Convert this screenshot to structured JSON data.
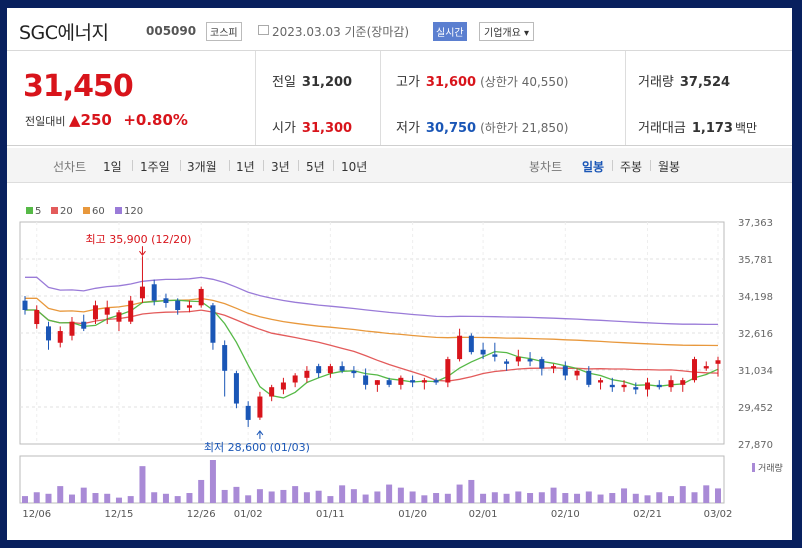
{
  "stock": {
    "name": "SGC에너지",
    "code": "005090",
    "market": "코스피",
    "date_note": "2023.03.03 기준(장마감)",
    "realtime_label": "실시간",
    "company_info_label": "기업개요 ▾"
  },
  "quote": {
    "price": "31,450",
    "change_label": "전일대비",
    "change_abs": "▲250",
    "change_pct": "+0.80%",
    "prev_close_label": "전일",
    "prev_close": "31,200",
    "high_label": "고가",
    "high": "31,600",
    "upper_limit_label": "(상한가 40,550)",
    "volume_label": "거래량",
    "volume": "37,524",
    "open_label": "시가",
    "open": "31,300",
    "low_label": "저가",
    "low": "30,750",
    "lower_limit_label": "(하한가 21,850)",
    "amount_label": "거래대금",
    "amount": "1,173",
    "amount_unit": "백만"
  },
  "tabs": {
    "line_chart_label": "선차트",
    "periods": [
      "1일",
      "1주일",
      "3개월",
      "1년",
      "3년",
      "5년",
      "10년"
    ],
    "candle_chart_label": "봉차트",
    "candle_periods": [
      "일봉",
      "주봉",
      "월봉"
    ],
    "selected_candle": "일봉"
  },
  "colors": {
    "up": "#d8141b",
    "down": "#1a56b6",
    "ma5": "#56b947",
    "ma20": "#e35b5b",
    "ma60": "#e8983c",
    "ma120": "#9a7bd8",
    "volume": "#a98ad6"
  },
  "chart_data": {
    "type": "candlestick",
    "legend": [
      {
        "name": "5",
        "color": "#56b947"
      },
      {
        "name": "20",
        "color": "#e35b5b"
      },
      {
        "name": "60",
        "color": "#e8983c"
      },
      {
        "name": "120",
        "color": "#9a7bd8"
      }
    ],
    "y_ticks": [
      "37,363",
      "35,781",
      "34,198",
      "32,616",
      "31,034",
      "29,452",
      "27,870"
    ],
    "ylim": [
      27870,
      37363
    ],
    "x_tick_labels": [
      {
        "label": "12/06",
        "index": 1
      },
      {
        "label": "12/15",
        "index": 8
      },
      {
        "label": "12/26",
        "index": 15
      },
      {
        "label": "01/02",
        "index": 19
      },
      {
        "label": "01/11",
        "index": 26
      },
      {
        "label": "01/20",
        "index": 33
      },
      {
        "label": "02/01",
        "index": 39
      },
      {
        "label": "02/10",
        "index": 46
      },
      {
        "label": "02/21",
        "index": 53
      },
      {
        "label": "03/02",
        "index": 59
      }
    ],
    "annotations": [
      {
        "text": "최고 35,900 (12/20)",
        "index": 10,
        "value": 35900,
        "kind": "high"
      },
      {
        "text": "최저 28,600 (01/03)",
        "index": 20,
        "value": 28600,
        "kind": "low"
      }
    ],
    "volume_label": "거래량",
    "candles": [
      {
        "o": 34000,
        "h": 34200,
        "l": 33400,
        "c": 33600
      },
      {
        "o": 33000,
        "h": 33800,
        "l": 32800,
        "c": 33600
      },
      {
        "o": 32900,
        "h": 33100,
        "l": 31900,
        "c": 32300
      },
      {
        "o": 32200,
        "h": 32900,
        "l": 32000,
        "c": 32700
      },
      {
        "o": 32500,
        "h": 33300,
        "l": 32300,
        "c": 33100
      },
      {
        "o": 33100,
        "h": 33400,
        "l": 32700,
        "c": 32800
      },
      {
        "o": 33200,
        "h": 34000,
        "l": 33000,
        "c": 33800
      },
      {
        "o": 33400,
        "h": 34000,
        "l": 33000,
        "c": 33700
      },
      {
        "o": 33100,
        "h": 33600,
        "l": 32700,
        "c": 33500
      },
      {
        "o": 33100,
        "h": 34200,
        "l": 33000,
        "c": 34000
      },
      {
        "o": 34100,
        "h": 35900,
        "l": 33900,
        "c": 34600
      },
      {
        "o": 34700,
        "h": 34900,
        "l": 33800,
        "c": 34000
      },
      {
        "o": 34100,
        "h": 34300,
        "l": 33700,
        "c": 33900
      },
      {
        "o": 34000,
        "h": 34100,
        "l": 33400,
        "c": 33600
      },
      {
        "o": 33700,
        "h": 34000,
        "l": 33500,
        "c": 33800
      },
      {
        "o": 33800,
        "h": 34600,
        "l": 33700,
        "c": 34500
      },
      {
        "o": 33800,
        "h": 33900,
        "l": 31900,
        "c": 32200
      },
      {
        "o": 32100,
        "h": 32300,
        "l": 29900,
        "c": 31000
      },
      {
        "o": 30900,
        "h": 31000,
        "l": 29400,
        "c": 29600
      },
      {
        "o": 29500,
        "h": 29700,
        "l": 28600,
        "c": 28900
      },
      {
        "o": 29000,
        "h": 30100,
        "l": 28900,
        "c": 29900
      },
      {
        "o": 29900,
        "h": 30400,
        "l": 29700,
        "c": 30300
      },
      {
        "o": 30200,
        "h": 30700,
        "l": 30000,
        "c": 30500
      },
      {
        "o": 30500,
        "h": 30900,
        "l": 30300,
        "c": 30800
      },
      {
        "o": 30700,
        "h": 31200,
        "l": 30500,
        "c": 31000
      },
      {
        "o": 31200,
        "h": 31300,
        "l": 30700,
        "c": 30900
      },
      {
        "o": 30900,
        "h": 31300,
        "l": 30700,
        "c": 31200
      },
      {
        "o": 31200,
        "h": 31400,
        "l": 30900,
        "c": 31000
      },
      {
        "o": 31000,
        "h": 31200,
        "l": 30700,
        "c": 30900
      },
      {
        "o": 30800,
        "h": 31100,
        "l": 30200,
        "c": 30400
      },
      {
        "o": 30400,
        "h": 30600,
        "l": 30100,
        "c": 30600
      },
      {
        "o": 30600,
        "h": 30700,
        "l": 30300,
        "c": 30400
      },
      {
        "o": 30400,
        "h": 30800,
        "l": 30200,
        "c": 30700
      },
      {
        "o": 30600,
        "h": 30800,
        "l": 30300,
        "c": 30500
      },
      {
        "o": 30500,
        "h": 30700,
        "l": 30200,
        "c": 30600
      },
      {
        "o": 30600,
        "h": 30700,
        "l": 30400,
        "c": 30500
      },
      {
        "o": 30500,
        "h": 31600,
        "l": 30300,
        "c": 31500
      },
      {
        "o": 31500,
        "h": 32800,
        "l": 31400,
        "c": 32500
      },
      {
        "o": 32500,
        "h": 32600,
        "l": 31700,
        "c": 31800
      },
      {
        "o": 31900,
        "h": 32200,
        "l": 31500,
        "c": 31700
      },
      {
        "o": 31700,
        "h": 32200,
        "l": 31400,
        "c": 31600
      },
      {
        "o": 31400,
        "h": 31500,
        "l": 31000,
        "c": 31300
      },
      {
        "o": 31400,
        "h": 31900,
        "l": 31200,
        "c": 31600
      },
      {
        "o": 31500,
        "h": 31800,
        "l": 31200,
        "c": 31400
      },
      {
        "o": 31500,
        "h": 31600,
        "l": 30800,
        "c": 31100
      },
      {
        "o": 31100,
        "h": 31300,
        "l": 30900,
        "c": 31200
      },
      {
        "o": 31200,
        "h": 31400,
        "l": 30600,
        "c": 30800
      },
      {
        "o": 30800,
        "h": 31100,
        "l": 30600,
        "c": 31000
      },
      {
        "o": 31000,
        "h": 31200,
        "l": 30300,
        "c": 30400
      },
      {
        "o": 30500,
        "h": 30700,
        "l": 30200,
        "c": 30600
      },
      {
        "o": 30400,
        "h": 30700,
        "l": 30100,
        "c": 30300
      },
      {
        "o": 30300,
        "h": 30600,
        "l": 30100,
        "c": 30400
      },
      {
        "o": 30300,
        "h": 30500,
        "l": 30000,
        "c": 30200
      },
      {
        "o": 30200,
        "h": 30700,
        "l": 29900,
        "c": 30500
      },
      {
        "o": 30400,
        "h": 30600,
        "l": 30200,
        "c": 30300
      },
      {
        "o": 30300,
        "h": 30800,
        "l": 30100,
        "c": 30600
      },
      {
        "o": 30400,
        "h": 30700,
        "l": 30100,
        "c": 30600
      },
      {
        "o": 30600,
        "h": 31600,
        "l": 30500,
        "c": 31500
      },
      {
        "o": 31100,
        "h": 31400,
        "l": 31000,
        "c": 31200
      },
      {
        "o": 31300,
        "h": 31600,
        "l": 30750,
        "c": 31450
      }
    ],
    "volume": [
      9,
      14,
      12,
      22,
      11,
      20,
      13,
      12,
      7,
      9,
      48,
      14,
      12,
      9,
      13,
      30,
      56,
      17,
      21,
      10,
      18,
      15,
      17,
      22,
      14,
      16,
      9,
      23,
      18,
      11,
      15,
      24,
      20,
      15,
      10,
      13,
      12,
      24,
      30,
      12,
      14,
      12,
      15,
      13,
      14,
      20,
      13,
      12,
      15,
      11,
      13,
      19,
      12,
      10,
      14,
      9,
      22,
      14,
      23,
      19,
      16,
      15
    ]
  }
}
